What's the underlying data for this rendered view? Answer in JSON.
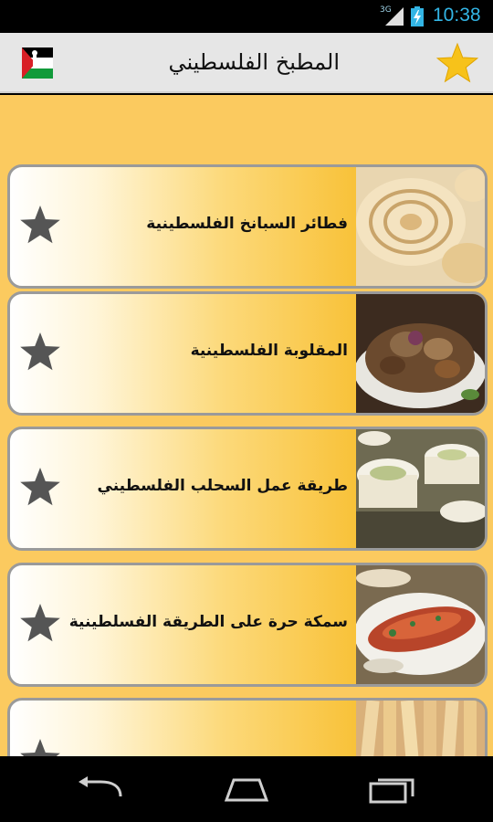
{
  "status_bar": {
    "network": "3G",
    "time": "10:38"
  },
  "app_bar": {
    "title": "المطبخ الفلسطيني",
    "flag_icon": "palestine-flag-icon",
    "favorite_icon": "star-icon"
  },
  "colors": {
    "content_bg": "#fbca5f",
    "card_accent": "#f5b820",
    "star": "#f7c21a",
    "status_clock": "#33b5e5"
  },
  "recipes": [
    {
      "label": "فطائر السبانخ الفلسطينية",
      "icon": "star-icon",
      "photo": "spinach-pastry-photo"
    },
    {
      "label": "المقلوبة الفلسطينية",
      "icon": "star-icon",
      "photo": "maqluba-photo"
    },
    {
      "label": "طريقة عمل السحلب الفلسطيني",
      "icon": "star-icon",
      "photo": "sahlab-photo"
    },
    {
      "label": "سمكة حرة على الطريقة الفسلطينية",
      "icon": "star-icon",
      "photo": "spicy-fish-photo"
    },
    {
      "label": "",
      "icon": "star-icon",
      "photo": "pastry-sticks-photo"
    }
  ],
  "nav_bar": {
    "back": "back-icon",
    "home": "home-icon",
    "recents": "recents-icon"
  }
}
